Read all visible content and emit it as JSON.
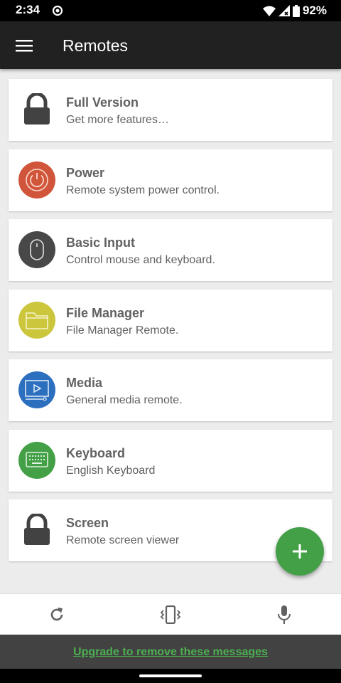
{
  "status_bar": {
    "time": "2:34",
    "battery": "92%",
    "icons": [
      "notification-icon",
      "wifi-icon",
      "signal-icon",
      "battery-icon"
    ]
  },
  "app_bar": {
    "title": "Remotes",
    "menu_icon": "hamburger-menu-icon"
  },
  "remotes": [
    {
      "name": "Full Version",
      "description": "Get more features…",
      "icon": "lock-icon",
      "color": "#424242"
    },
    {
      "name": "Power",
      "description": "Remote system power control.",
      "icon": "power-icon",
      "color": "#d0553a"
    },
    {
      "name": "Basic Input",
      "description": "Control mouse and keyboard.",
      "icon": "mouse-icon",
      "color": "#484848"
    },
    {
      "name": "File Manager",
      "description": "File Manager Remote.",
      "icon": "folder-icon",
      "color": "#cbc63c"
    },
    {
      "name": "Media",
      "description": "General media remote.",
      "icon": "media-icon",
      "color": "#2d6fbf"
    },
    {
      "name": "Keyboard",
      "description": "English Keyboard",
      "icon": "keyboard-icon",
      "color": "#43a047"
    },
    {
      "name": "Screen",
      "description": "Remote screen viewer",
      "icon": "lock-icon",
      "color": "#424242"
    }
  ],
  "fab": {
    "icon": "plus-icon",
    "color": "#43a047"
  },
  "bottom_bar": {
    "icons": [
      "refresh-icon",
      "phone-vibrate-icon",
      "microphone-icon"
    ]
  },
  "banner": {
    "text": "Upgrade to remove these messages"
  },
  "colors": {
    "app_bar": "#212121",
    "background": "#ececec",
    "accent": "#43a047",
    "banner": "#424242"
  }
}
